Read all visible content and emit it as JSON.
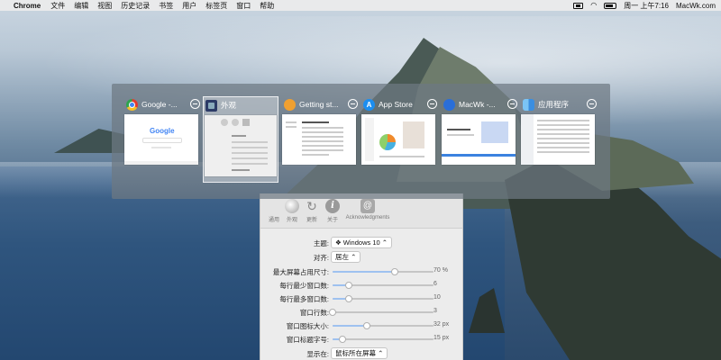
{
  "menubar": {
    "app_name": "Chrome",
    "menus": [
      "文件",
      "编辑",
      "视图",
      "历史记录",
      "书签",
      "用户",
      "标签页",
      "窗口",
      "帮助"
    ],
    "status_icons": [
      "screen-icon",
      "wifi-icon",
      "battery-icon"
    ],
    "clock": "周一 上午7:16",
    "site": "MacWk.com"
  },
  "switcher": {
    "windows": [
      {
        "title": "Google -...",
        "icon": "chrome-icon",
        "active": false
      },
      {
        "title": "外观",
        "icon": "appearance-icon",
        "active": true
      },
      {
        "title": "Getting st...",
        "icon": "getting-started-icon",
        "active": false
      },
      {
        "title": "App Store",
        "icon": "app-store-icon",
        "active": false
      },
      {
        "title": "MacWk -...",
        "icon": "macwk-icon",
        "active": false
      },
      {
        "title": "应用程序",
        "icon": "finder-icon",
        "active": false
      }
    ],
    "google_logo": "Google",
    "appstore_glyph": "A"
  },
  "prefs": {
    "toolbar": {
      "general": "通用",
      "appearance": "外观",
      "update": "更新",
      "about": "关于",
      "ack": "Acknowledgments"
    },
    "rows": {
      "theme": {
        "label": "主题:",
        "value": "❖ Windows 10 ⌃"
      },
      "align": {
        "label": "对齐:",
        "value": "居左 ⌃"
      },
      "max_size": {
        "label": "最大屏幕占用尺寸:",
        "value": "70 %",
        "fraction": 0.62
      },
      "min_per_row": {
        "label": "每行最少窗口数:",
        "value": "6",
        "fraction": 0.16
      },
      "max_per_row": {
        "label": "每行最多窗口数:",
        "value": "10",
        "fraction": 0.16
      },
      "rows": {
        "label": "窗口行数:",
        "value": "3",
        "fraction": 0.0
      },
      "icon_size": {
        "label": "窗口图标大小:",
        "value": "32 px",
        "fraction": 0.34
      },
      "title_font": {
        "label": "窗口标题字号:",
        "value": "15 px",
        "fraction": 0.1
      },
      "display_on": {
        "label": "显示在:",
        "value": "鼠标所在屏幕 ⌃"
      }
    }
  }
}
